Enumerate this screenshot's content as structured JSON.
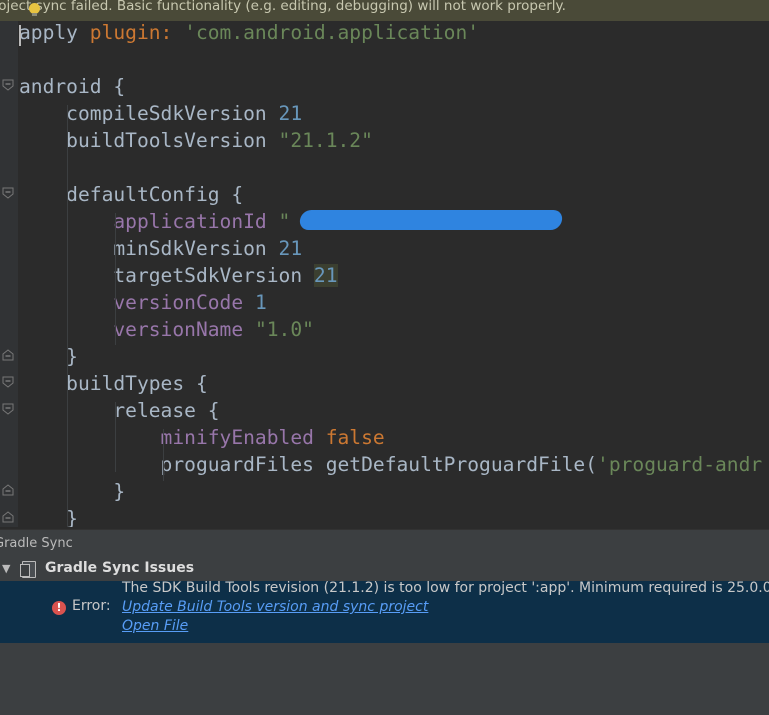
{
  "banner": {
    "message": "roject sync failed. Basic functionality (e.g. editing, debugging) will not work properly."
  },
  "editor": {
    "lines": [
      {
        "segments": [
          {
            "t": "apply ",
            "c": "plain"
          },
          {
            "t": "plugin: ",
            "c": "kw"
          },
          {
            "t": "'com.android.application'",
            "c": "str"
          }
        ]
      },
      {
        "segments": []
      },
      {
        "segments": [
          {
            "t": "android {",
            "c": "plain"
          }
        ]
      },
      {
        "segments": [
          {
            "t": "    compileSdkVersion ",
            "c": "plain"
          },
          {
            "t": "21",
            "c": "num"
          }
        ]
      },
      {
        "segments": [
          {
            "t": "    buildToolsVersion ",
            "c": "plain"
          },
          {
            "t": "\"21.1.2\"",
            "c": "str"
          }
        ]
      },
      {
        "segments": []
      },
      {
        "segments": [
          {
            "t": "    defaultConfig {",
            "c": "plain"
          }
        ]
      },
      {
        "segments": [
          {
            "t": "        applicationId ",
            "c": "prop"
          },
          {
            "t": "\"                      \"",
            "c": "str"
          }
        ]
      },
      {
        "segments": [
          {
            "t": "        minSdkVersion ",
            "c": "plain"
          },
          {
            "t": "21",
            "c": "num"
          }
        ]
      },
      {
        "segments": [
          {
            "t": "        targetSdkVersion ",
            "c": "plain"
          },
          {
            "t": "21",
            "c": "num hl"
          }
        ]
      },
      {
        "segments": [
          {
            "t": "        versionCode ",
            "c": "prop"
          },
          {
            "t": "1",
            "c": "num"
          }
        ]
      },
      {
        "segments": [
          {
            "t": "        versionName ",
            "c": "prop"
          },
          {
            "t": "\"1.0\"",
            "c": "str"
          }
        ]
      },
      {
        "segments": [
          {
            "t": "    }",
            "c": "plain"
          }
        ]
      },
      {
        "segments": [
          {
            "t": "    buildTypes {",
            "c": "plain"
          }
        ]
      },
      {
        "segments": [
          {
            "t": "        release {",
            "c": "plain"
          }
        ]
      },
      {
        "segments": [
          {
            "t": "            minifyEnabled ",
            "c": "prop"
          },
          {
            "t": "false",
            "c": "kw"
          }
        ]
      },
      {
        "segments": [
          {
            "t": "            proguardFiles getDefaultProguardFile(",
            "c": "plain"
          },
          {
            "t": "'proguard-andr",
            "c": "str"
          }
        ]
      },
      {
        "segments": [
          {
            "t": "        }",
            "c": "plain"
          }
        ]
      },
      {
        "segments": [
          {
            "t": "    }",
            "c": "plain"
          }
        ]
      }
    ]
  },
  "panel": {
    "title": "Gradle Sync",
    "header": "Gradle Sync Issues",
    "error_label": "Error:",
    "error_message": "The SDK Build Tools revision (21.1.2) is too low for project ':app'. Minimum required is 25.0.0",
    "link_update": "Update Build Tools version and sync project",
    "link_open": "Open File"
  },
  "colors": {
    "keyword": "#cc7832",
    "string": "#6a8759",
    "number": "#6897bb",
    "property": "#9876aa",
    "link": "#589df6",
    "error_bg": "#0d2f48"
  },
  "icons": {
    "banner": "lightbulb-icon",
    "error": "error-icon",
    "tree_expand": "triangle-down-icon",
    "gradle": "gradle-sync-icon"
  }
}
